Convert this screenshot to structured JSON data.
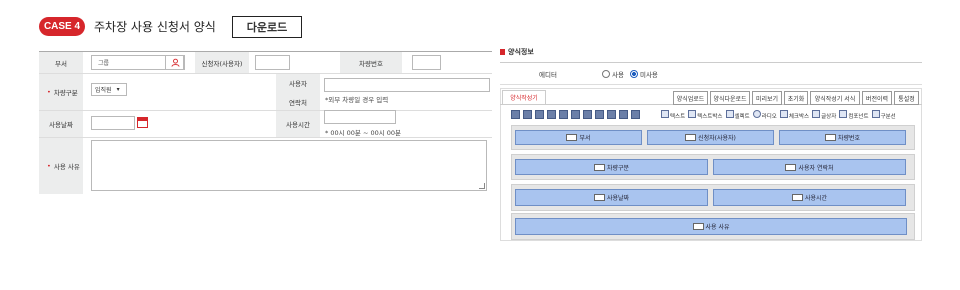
{
  "header": {
    "badge": "CASE 4",
    "title": "주차장 사용 신청서 양식",
    "download_label": "다운로드"
  },
  "form": {
    "dept_label": "부서",
    "dept_value": "그룹",
    "applicant_label": "신청자(사용자)",
    "car_number_label": "차량번호",
    "car_type_label": "차량구분",
    "car_type_value": "임직원",
    "user_label": "사용자",
    "contact_label": "연락처",
    "contact_note": "*외부 차량일 경우 입력",
    "date_label": "사용날짜",
    "time_label": "사용시간",
    "time_note": "* 00시 00분 ~ 00시 00분",
    "reason_label": "사용 사유"
  },
  "panel": {
    "title": "양식정보",
    "editor_label": "에디터",
    "editor_options": [
      "사용",
      "미사용"
    ],
    "editor_selected": "미사용",
    "tab_label": "양식작성기",
    "buttons": [
      "양식업로드",
      "양식다운로드",
      "미리보기",
      "초기화",
      "양식작성기 서식",
      "버전이력",
      "통설정"
    ],
    "palette": [
      "텍스트",
      "텍스트박스",
      "셀렉트",
      "라디오",
      "체크박스",
      "글상자",
      "컴포넌트",
      "구분선"
    ],
    "rows": [
      [
        "부서",
        "신청자(사용자)",
        "차량번호"
      ],
      [
        "차량구분",
        "사용자 연락처"
      ],
      [
        "사용날짜",
        "사용시간"
      ],
      [
        "사용 사유"
      ]
    ]
  },
  "colors": {
    "accent": "#d6262b",
    "field_blue": "#a9c4ef",
    "label_gray": "#eceded"
  }
}
